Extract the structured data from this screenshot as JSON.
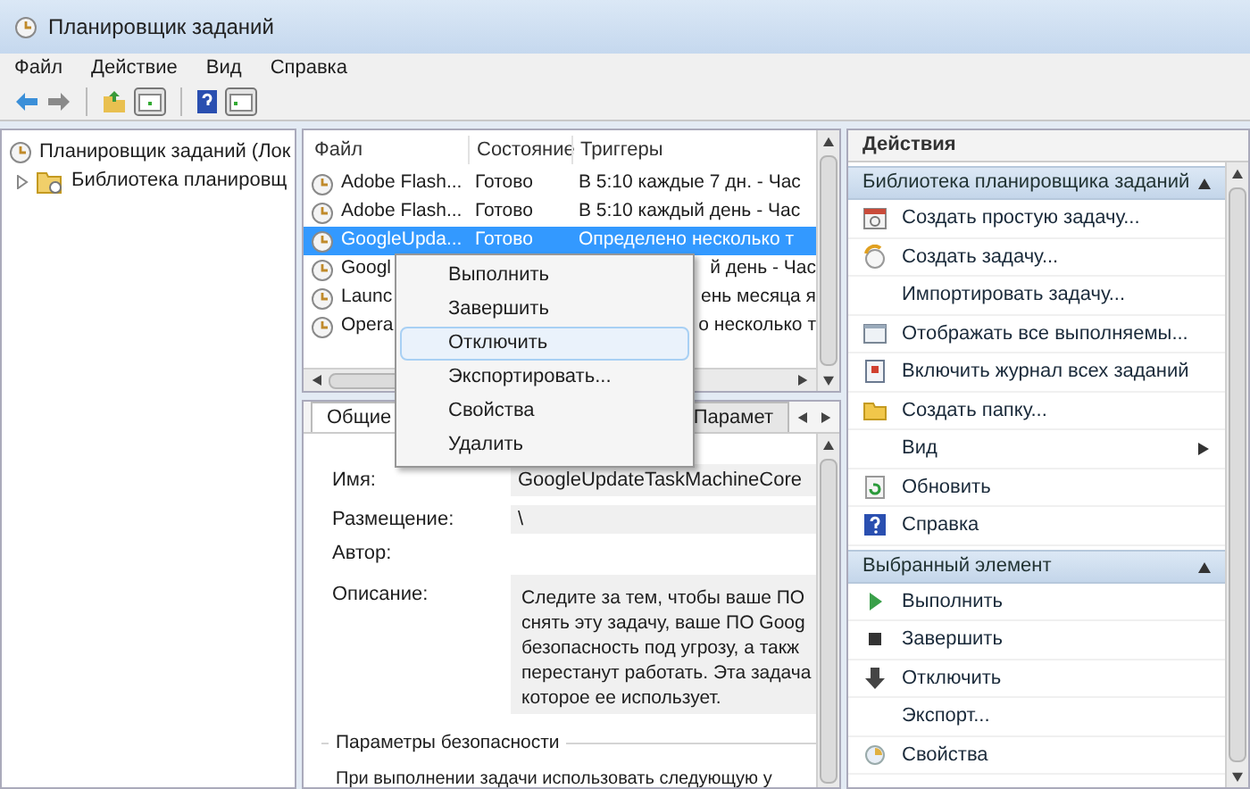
{
  "window": {
    "title": "Планировщик заданий"
  },
  "menu": [
    "Файл",
    "Действие",
    "Вид",
    "Справка"
  ],
  "tree": [
    {
      "label": "Планировщик заданий (Лок",
      "children": [
        {
          "label": "Библиотека планировщ",
          "expanded": false
        }
      ]
    }
  ],
  "task_table": {
    "columns": [
      "Файл",
      "Состояние",
      "Триггеры"
    ],
    "rows": [
      {
        "file": "Adobe Flash...",
        "status": "Готово",
        "trigger": "В 5:10 каждые 7 дн. - Час",
        "selected": false
      },
      {
        "file": "Adobe Flash...",
        "status": "Готово",
        "trigger": "В 5:10 каждый день - Час",
        "selected": false
      },
      {
        "file": "GoogleUpda...",
        "status": "Готово",
        "trigger": "Определено несколько т",
        "selected": true
      },
      {
        "file": "Googl",
        "trigger": "й день - Час",
        "selected": false
      },
      {
        "file": "Launc",
        "trigger": "ень месяца я",
        "selected": false
      },
      {
        "file": "Opera",
        "trigger": "о несколько т",
        "selected": false
      }
    ]
  },
  "context_menu": [
    {
      "label": "Выполнить",
      "selected": false
    },
    {
      "label": "Завершить",
      "selected": false
    },
    {
      "label": "Отключить",
      "selected": true
    },
    {
      "label": "Экспортировать...",
      "selected": false
    },
    {
      "label": "Свойства",
      "selected": false
    },
    {
      "label": "Удалить",
      "selected": false
    }
  ],
  "details": {
    "tabs": [
      {
        "label": "Общие",
        "selected": true
      },
      {
        "label": "Парамет",
        "selected": false
      }
    ],
    "name_label": "Имя:",
    "name_value": "GoogleUpdateTaskMachineCore",
    "location_label": "Размещение:",
    "location_value": "\\",
    "author_label": "Автор:",
    "description_label": "Описание:",
    "description_lines": [
      "Следите за тем, чтобы ваше ПО",
      "снять эту задачу, ваше ПО Goog",
      "безопасность под угрозу, а такж",
      "перестанут работать. Эта задача",
      "которое ее использует."
    ],
    "security_title": "Параметры безопасности",
    "security_text": "При выполнении задачи использовать следующую у"
  },
  "actions": {
    "title": "Действия",
    "sections": [
      {
        "title": "Библиотека планировщика заданий",
        "expanded": true,
        "items": [
          {
            "label": "Создать простую задачу..."
          },
          {
            "label": "Создать задачу..."
          },
          {
            "label": "Импортировать задачу..."
          },
          {
            "label": "Отображать все выполняемы..."
          },
          {
            "label": "Включить журнал всех заданий"
          },
          {
            "label": "Создать папку..."
          },
          {
            "label": "Вид",
            "submenu": true
          },
          {
            "label": "Обновить"
          },
          {
            "label": "Справка"
          }
        ]
      },
      {
        "title": "Выбранный элемент",
        "expanded": true,
        "items": [
          {
            "label": "Выполнить"
          },
          {
            "label": "Завершить"
          },
          {
            "label": "Отключить"
          },
          {
            "label": "Экспорт..."
          },
          {
            "label": "Свойства"
          }
        ]
      }
    ]
  }
}
